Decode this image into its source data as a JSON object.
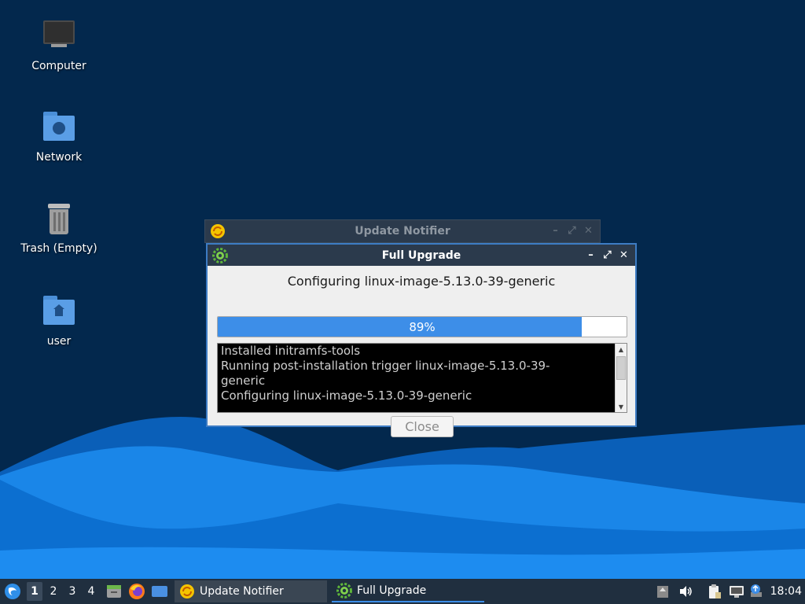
{
  "desktop": {
    "icons": [
      {
        "label": "Computer",
        "icon": "computer-icon"
      },
      {
        "label": "Network",
        "icon": "network-folder-icon"
      },
      {
        "label": "Trash (Empty)",
        "icon": "trash-icon"
      },
      {
        "label": "user",
        "icon": "home-folder-icon"
      }
    ]
  },
  "update_notifier": {
    "title": "Update Notifier",
    "icon": "update-notifier-icon",
    "buttons": {
      "minimize": "–",
      "maximize": "⤢",
      "close": "✕"
    }
  },
  "full_upgrade": {
    "title": "Full Upgrade",
    "icon": "gear-icon",
    "buttons": {
      "minimize": "–",
      "maximize": "⤢",
      "close": "✕"
    },
    "status": "Configuring linux-image-5.13.0-39-generic",
    "progress": {
      "percent": 89,
      "label": "89%"
    },
    "log": [
      "Installed initramfs-tools",
      "Running post-installation trigger linux-image-5.13.0-39-",
      "generic",
      "Configuring linux-image-5.13.0-39-generic"
    ],
    "close_label": "Close"
  },
  "taskbar": {
    "menu_icon": "lubuntu-menu-icon",
    "workspaces": [
      "1",
      "2",
      "3",
      "4"
    ],
    "active_workspace": "1",
    "launchers": [
      "file-manager-icon",
      "firefox-icon",
      "show-desktop-icon"
    ],
    "tasks": [
      {
        "label": "Update Notifier",
        "icon": "update-notifier-icon"
      },
      {
        "label": "Full Upgrade",
        "icon": "gear-icon"
      }
    ],
    "tray": [
      "updates-tray-icon",
      "volume-icon",
      "clipboard-icon",
      "network-icon",
      "upload-icon"
    ],
    "clock": "18:04"
  },
  "colors": {
    "desktop_bg": "#03284d",
    "accent": "#3d8ee8",
    "titlebar": "#2b3a4c"
  }
}
